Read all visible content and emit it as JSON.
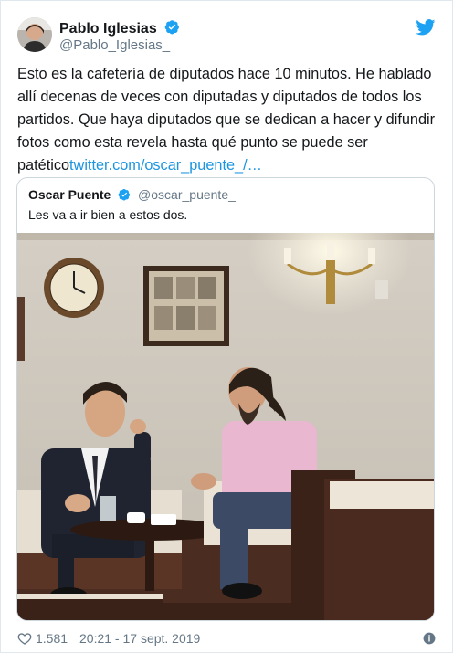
{
  "tweet": {
    "author": {
      "name": "Pablo Iglesias",
      "handle": "@Pablo_Iglesias_",
      "verified": true
    },
    "text": "Esto es la cafetería de diputados hace 10 minutos. He hablado allí decenas de veces con diputadas y diputados de todos los partidos. Que haya diputados que se dedican a hacer y difundir fotos como esta revela hasta qué punto se puede ser patético",
    "link": "twitter.com/oscar_puente_/…",
    "quote": {
      "author_name": "Oscar Puente",
      "author_handle": "@oscar_puente_",
      "verified": true,
      "text": "Les va a ir bien a estos dos."
    },
    "likes": "1.581",
    "timestamp": "20:21 - 17 sept. 2019"
  },
  "icons": {
    "brand": "twitter-bird-icon",
    "verified": "verified-badge-icon",
    "like": "heart-icon",
    "info": "info-icon"
  },
  "colors": {
    "text": "#14171a",
    "muted": "#657786",
    "link": "#1b95e0",
    "verified": "#1da1f2",
    "border": "#ccd6dd"
  }
}
